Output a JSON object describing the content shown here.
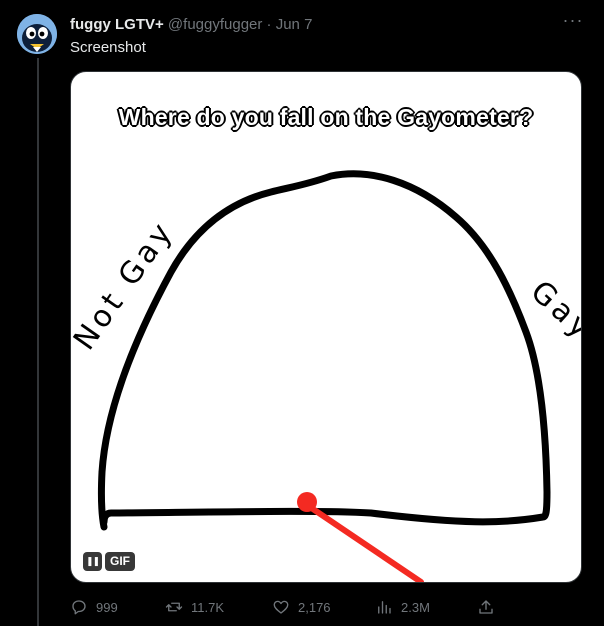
{
  "tweet": {
    "display_name": "fuggy LGTV+",
    "handle": "@fuggyfugger",
    "separator": "·",
    "date": "Jun 7",
    "more_label": "···",
    "text": "Screenshot"
  },
  "media": {
    "title": "Where do you fall on the Gayometer?",
    "label_left": "Not Gay",
    "label_right": "Gay",
    "gif_label": "GIF",
    "pause_label": "❚❚",
    "pointer_color": "#f42a22"
  },
  "actions": {
    "replies": "999",
    "retweets": "11.7K",
    "likes": "2,176",
    "views": "2.3M"
  },
  "colors": {
    "background": "#000000",
    "text_primary": "#e7e9ea",
    "text_secondary": "#71767b"
  }
}
